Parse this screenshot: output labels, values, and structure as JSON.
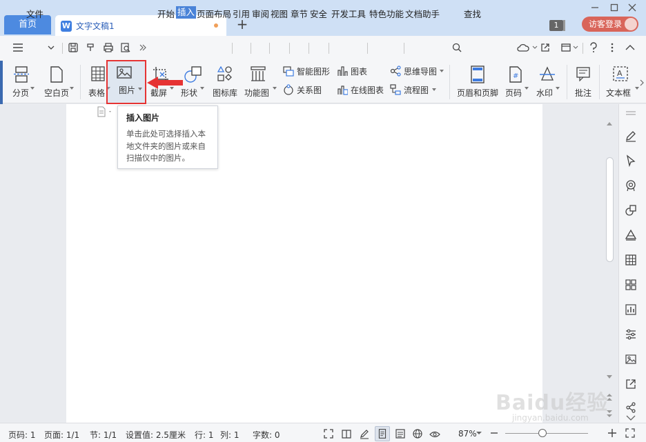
{
  "tabs": {
    "home": "首页",
    "doc": "文字文稿1",
    "new": "+"
  },
  "titlebar": {
    "badge": "1",
    "login": "访客登录"
  },
  "menu": {
    "file": "文件",
    "items": [
      "开始",
      "插入",
      "页面布局",
      "引用",
      "审阅",
      "视图",
      "章节",
      "安全",
      "开发工具",
      "特色功能",
      "文档助手"
    ],
    "selected": "插入",
    "search": "查找"
  },
  "ribbon": {
    "page_break": "分页",
    "blank_page": "空白页",
    "table": "表格",
    "picture": "图片",
    "screenshot": "截屏",
    "shapes": "形状",
    "icon_lib": "图标库",
    "func_chart": "功能图",
    "smart_art": "智能图形",
    "relation": "关系图",
    "chart": "图表",
    "online_chart": "在线图表",
    "mindmap": "思维导图",
    "flowchart": "流程图",
    "header_footer": "页眉和页脚",
    "page_num": "页码",
    "watermark": "水印",
    "comment": "批注",
    "textbox": "文本框"
  },
  "tooltip": {
    "title": "插入图片",
    "desc": "单击此处可选择插入本地文件夹的图片或来自扫描仪中的图片。"
  },
  "status": {
    "page_num": "页码: 1",
    "pages": "页面: 1/1",
    "section": "节: 1/1",
    "setting": "设置值: 2.5厘米",
    "row": "行: 1",
    "col": "列: 1",
    "words": "字数: 0",
    "zoom": "87%",
    "zoom_level": 0.45
  },
  "watermark": {
    "text": "Baidu经验",
    "url": "jingyan.baidu.com"
  },
  "colors": {
    "accent": "#4a83d8",
    "highlight": "#e63333",
    "login": "#d9655a"
  }
}
